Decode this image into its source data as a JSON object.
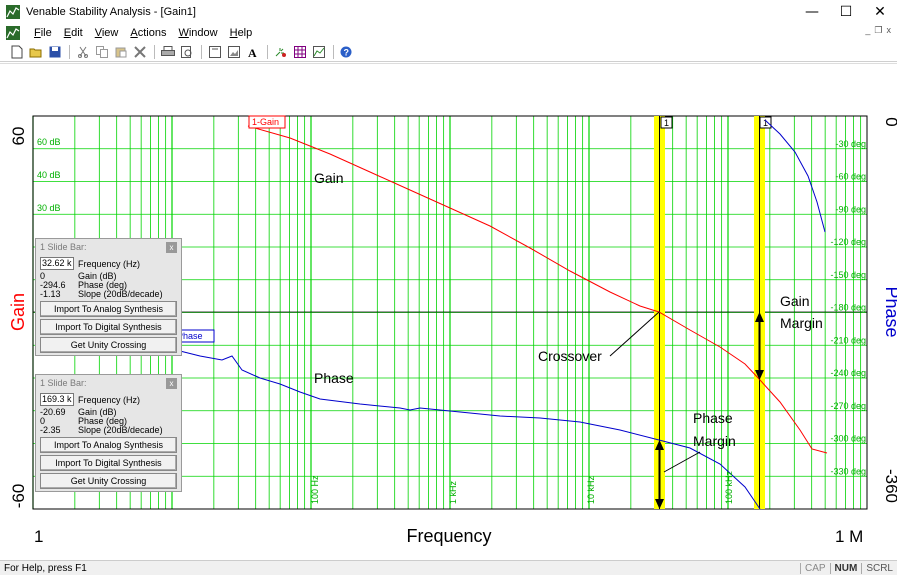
{
  "window": {
    "title": "Venable Stability Analysis - [Gain1]",
    "minimize": "—",
    "maximize": "☐",
    "close": "✕"
  },
  "menu": {
    "items": [
      "File",
      "Edit",
      "View",
      "Actions",
      "Window",
      "Help"
    ],
    "underline": [
      "F",
      "E",
      "V",
      "A",
      "W",
      "H"
    ]
  },
  "mdi": {
    "min": "_",
    "restore": "❐",
    "close": "x"
  },
  "toolbar": {
    "icons": [
      "new-icon",
      "open-icon",
      "save-icon",
      "cut-icon",
      "copy-icon",
      "paste-icon",
      "delete-icon",
      "print-icon",
      "print-preview-icon",
      "frame-icon",
      "picture-icon",
      "font-icon",
      "sparkle-icon",
      "grid-icon",
      "graph-icon",
      "help-icon"
    ]
  },
  "plot": {
    "xaxis_left": "1",
    "xaxis_right": "1 M",
    "xlabel": "Frequency",
    "ylabel_left": "Gain",
    "ylabel_right": "Phase",
    "gain_top": "60",
    "gain_bottom": "-60",
    "phase_top": "0",
    "phase_bottom": "-360",
    "gain_ticks": [
      "60 dB",
      "40 dB",
      "30 dB"
    ],
    "phase_ticks": [
      "-30 deg",
      "-60 deg",
      "-90 deg",
      "-120 deg",
      "-150 deg",
      "-180 deg",
      "-210 deg",
      "-240 deg",
      "-270 deg",
      "-300 deg",
      "-330 deg"
    ],
    "freq_ticks": [
      "100 Hz",
      "1 kHz",
      "10 kHz",
      "100 kHz"
    ],
    "gain_trace_label": "1-Gain",
    "phase_trace_label": "1-Phase",
    "cursor_label_1": "1",
    "cursor_label_2": "1",
    "annotations": {
      "gain": "Gain",
      "phase": "Phase",
      "crossover": "Crossover",
      "gain_margin_1": "Gain",
      "gain_margin_2": "Margin",
      "phase_margin_1": "Phase",
      "phase_margin_2": "Margin"
    },
    "colors": {
      "grid": "#00d400",
      "gain": "#ff0000",
      "phase": "#0000cc",
      "cursor": "#ffff00"
    }
  },
  "slidebar1": {
    "title": "1 Slide Bar:",
    "close": "x",
    "frequency": "32.62 k",
    "frequency_label": "Frequency (Hz)",
    "rows": [
      {
        "value": "0",
        "label": "Gain (dB)"
      },
      {
        "value": "-294.6",
        "label": "Phase (deg)"
      },
      {
        "value": "-1.13",
        "label": "Slope (20dB/decade)"
      }
    ],
    "btn_analog": "Import To Analog Synthesis",
    "btn_digital": "Import To Digital Synthesis",
    "btn_unity": "Get Unity Crossing"
  },
  "slidebar2": {
    "title": "1 Slide Bar:",
    "close": "x",
    "frequency": "169.3 k",
    "frequency_label": "Frequency (Hz)",
    "rows": [
      {
        "value": "-20.69",
        "label": "Gain (dB)"
      },
      {
        "value": "0",
        "label": "Phase (deg)"
      },
      {
        "value": "-2.35",
        "label": "Slope (20dB/decade)"
      }
    ],
    "btn_analog": "Import To Analog Synthesis",
    "btn_digital": "Import To Digital Synthesis",
    "btn_unity": "Get Unity Crossing"
  },
  "status": {
    "help": "For Help, press F1",
    "cap": "CAP",
    "num": "NUM",
    "scrl": "SCRL"
  }
}
